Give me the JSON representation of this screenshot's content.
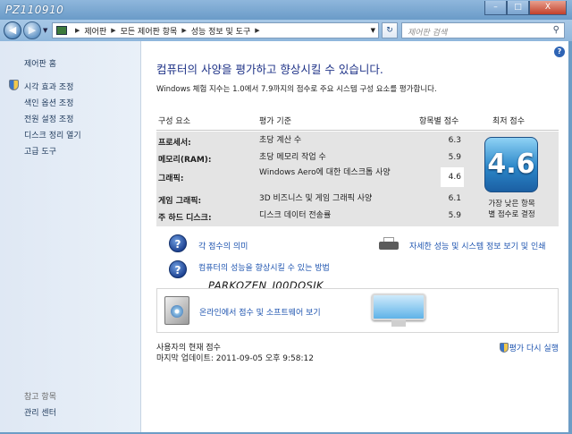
{
  "watermark_top": "PZ110910",
  "watermark_mid": "PARKOZEN_I00DOSIK",
  "window_buttons": {
    "minimize": "–",
    "maximize": "□",
    "close": "X"
  },
  "address": {
    "crumbs": [
      "제어판",
      "모든 제어판 항목",
      "성능 정보 및 도구"
    ],
    "search_placeholder": "제어판 검색"
  },
  "sidebar": {
    "home": "제어판 홈",
    "items": [
      "시각 효과 조정",
      "색인 옵션 조정",
      "전원 설정 조정",
      "디스크 정리 열기",
      "고급 도구"
    ],
    "see_also_heading": "참고 항목",
    "see_also_items": [
      "관리 센터"
    ]
  },
  "main": {
    "title": "컴퓨터의 사양을 평가하고 향상시킬 수 있습니다.",
    "subtitle": "Windows 체험 지수는 1.0에서 7.9까지의 점수로 주요 시스템 구성 요소를 평가합니다.",
    "columns": {
      "component": "구성 요소",
      "rated": "평가 기준",
      "subscore": "항목별 점수",
      "base": "최저 점수"
    },
    "rows": [
      {
        "component": "프로세서:",
        "rated": "초당 계산 수",
        "score": "6.3"
      },
      {
        "component": "메모리(RAM):",
        "rated": "초당 메모리 작업 수",
        "score": "5.9"
      },
      {
        "component": "그래픽:",
        "rated": "Windows Aero에 대한 데스크톱 사양",
        "score": "4.6"
      },
      {
        "component": "게임 그래픽:",
        "rated": "3D 비즈니스 및 게임 그래픽 사양",
        "score": "6.1"
      },
      {
        "component": "주 하드 디스크:",
        "rated": "디스크 데이터 전송률",
        "score": "5.9"
      }
    ],
    "base_score": "4.6",
    "base_caption_line1": "가장 낮은 항목",
    "base_caption_line2": "별 점수로 결정",
    "links": {
      "meaning": "각 점수의 의미",
      "improve": "컴퓨터의 성능을 향상시킬 수 있는 방법",
      "details": "자세한 성능 및 시스템 정보 보기 및 인쇄",
      "online": "온라인에서 점수 및 소프트웨어 보기"
    },
    "footer": {
      "current": "사용자의 현재 점수",
      "last_update": "마지막 업데이트: 2011-09-05 오후 9:58:12",
      "rerun": "평가 다시 실행"
    }
  }
}
